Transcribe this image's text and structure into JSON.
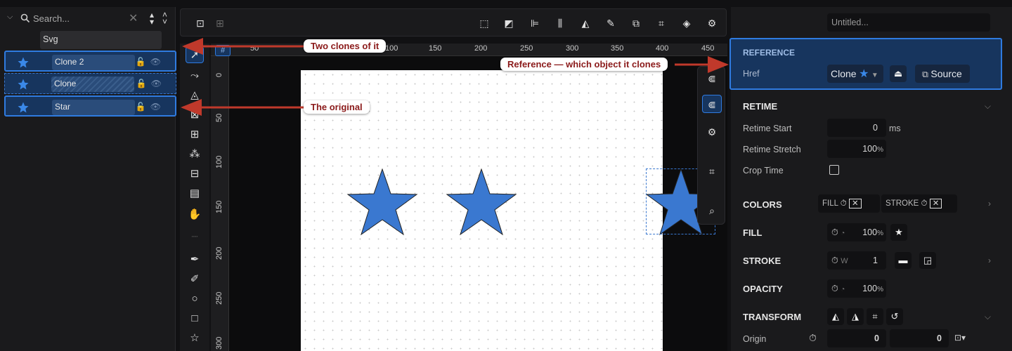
{
  "layers": {
    "search_placeholder": "Search...",
    "root": "Svg",
    "items": [
      {
        "name": "Clone 2"
      },
      {
        "name": "Clone"
      },
      {
        "name": "Star"
      }
    ]
  },
  "ruler": {
    "top_ticks": [
      "50",
      "100",
      "150",
      "200",
      "250",
      "300",
      "350",
      "400",
      "450"
    ],
    "left_ticks": [
      "0",
      "50",
      "100",
      "150",
      "200",
      "250",
      "300"
    ]
  },
  "props": {
    "title_placeholder": "Untitled...",
    "reference": {
      "title": "REFERENCE",
      "href_label": "Href",
      "href_value": "Clone",
      "source_label": "Source"
    },
    "retime": {
      "title": "RETIME",
      "start_label": "Retime Start",
      "start_value": "0",
      "start_unit": "ms",
      "stretch_label": "Retime Stretch",
      "stretch_value": "100",
      "stretch_unit": "%",
      "crop_label": "Crop Time"
    },
    "colors": {
      "title": "COLORS",
      "fill": "FILL",
      "stroke": "STROKE"
    },
    "fill": {
      "title": "FILL",
      "value": "100",
      "unit": "%"
    },
    "stroke": {
      "title": "STROKE",
      "w_label": "W",
      "w_value": "1"
    },
    "opacity": {
      "title": "OPACITY",
      "value": "100",
      "unit": "%"
    },
    "transform": {
      "title": "TRANSFORM",
      "origin_label": "Origin",
      "origin_x": "0",
      "origin_y": "0"
    }
  },
  "callouts": {
    "clones": "Two clones of it",
    "reference": "Reference — which object it clones",
    "original": "The original"
  },
  "colors": {
    "accent": "#2f7be0",
    "star_fill": "#3a78d0",
    "callout_text": "#8b1a1a",
    "arrow": "#c0392b"
  }
}
